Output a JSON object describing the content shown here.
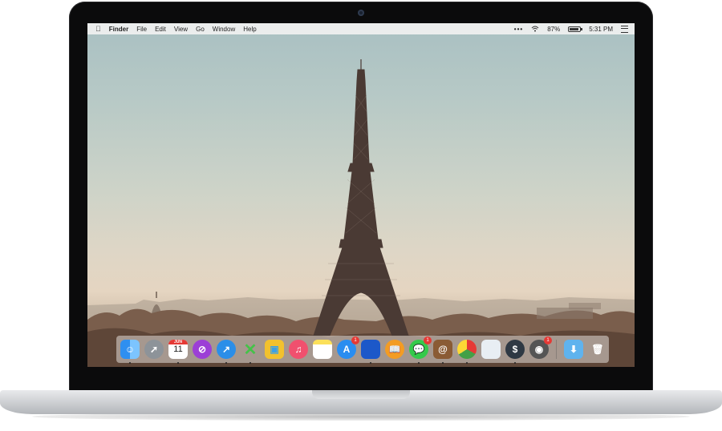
{
  "menubar": {
    "apple_glyph": "",
    "app_name": "Finder",
    "menus": [
      "File",
      "Edit",
      "View",
      "Go",
      "Window",
      "Help"
    ],
    "status": {
      "dots": "•••",
      "battery_percent": "87%",
      "time": "5:31 PM"
    }
  },
  "battery_level": 0.87,
  "dock": {
    "items": [
      {
        "icon": "finder-icon",
        "glyph": "☺",
        "running": true
      },
      {
        "icon": "launchpad-icon",
        "glyph": "➚",
        "running": false
      },
      {
        "icon": "calendar-icon",
        "month": "JUN",
        "day": "11",
        "running": true
      },
      {
        "icon": "safari-compass-icon",
        "glyph": "⊘",
        "running": false
      },
      {
        "icon": "xcode-icon",
        "glyph": "↗",
        "running": true
      },
      {
        "icon": "close-x-icon",
        "glyph": "✕",
        "running": true
      },
      {
        "icon": "preview-icon",
        "glyph": "▣",
        "running": false
      },
      {
        "icon": "music-icon",
        "glyph": "♫",
        "running": false
      },
      {
        "icon": "notes-icon",
        "glyph": "",
        "running": false
      },
      {
        "icon": "app-store-icon",
        "glyph": "A",
        "badge": "1",
        "running": false
      },
      {
        "icon": "book-blue-icon",
        "glyph": "",
        "running": true
      },
      {
        "icon": "ibooks-icon",
        "glyph": "📖",
        "running": false
      },
      {
        "icon": "messages-icon",
        "glyph": "💬",
        "badge": "1",
        "running": true
      },
      {
        "icon": "contacts-icon",
        "glyph": "@",
        "running": true
      },
      {
        "icon": "chrome-icon",
        "glyph": "",
        "running": true
      },
      {
        "icon": "folder-white-icon",
        "glyph": "",
        "running": false
      },
      {
        "icon": "dollar-icon",
        "glyph": "$",
        "running": true
      },
      {
        "icon": "camera-lens-icon",
        "glyph": "◉",
        "badge": "1",
        "running": false
      }
    ],
    "right_items": [
      {
        "icon": "downloads-folder-icon",
        "glyph": "⬇"
      },
      {
        "icon": "trash-icon",
        "glyph": "🗑"
      }
    ]
  }
}
